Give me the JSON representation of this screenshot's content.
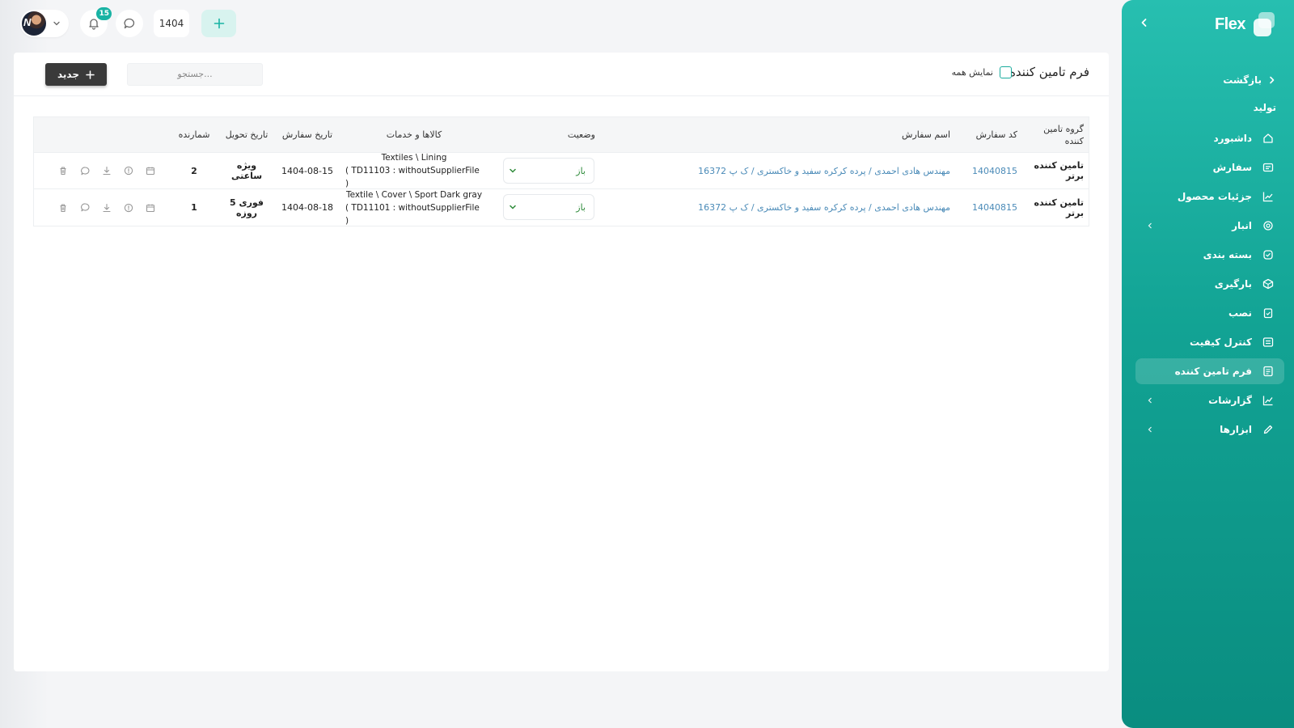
{
  "colors": {
    "accent": "#19b3a4",
    "link": "#4b8bb8",
    "status_open": "#2e8b3a",
    "dark_button": "#3a3a3a"
  },
  "topbar": {
    "avatar_initial": "N",
    "notifications_count": "15",
    "year": "1404"
  },
  "sidebar": {
    "logo": "Flex",
    "back_label": "بازگشت",
    "section_label": "تولید",
    "items": [
      {
        "label": "داشبورد",
        "icon": "home-icon"
      },
      {
        "label": "سفارش",
        "icon": "order-icon"
      },
      {
        "label": "جزئیات محصول",
        "icon": "chart-line-icon"
      },
      {
        "label": "انبار",
        "icon": "warehouse-icon",
        "has_children": true
      },
      {
        "label": "بسته بندی",
        "icon": "package-check-icon"
      },
      {
        "label": "بارگیری",
        "icon": "box-icon"
      },
      {
        "label": "نصب",
        "icon": "install-icon"
      },
      {
        "label": "کنترل کیفیت",
        "icon": "quality-icon"
      },
      {
        "label": "فرم تامین کننده",
        "icon": "form-icon",
        "active": true
      },
      {
        "label": "گزارشات",
        "icon": "report-icon",
        "has_children": true
      },
      {
        "label": "ابزارها",
        "icon": "pencil-icon",
        "has_children": true
      }
    ]
  },
  "page": {
    "title": "فرم تامین کننده",
    "show_all_label": "نمایش همه",
    "search_placeholder": "جستجو...",
    "new_button_label": "جدید"
  },
  "table": {
    "columns": {
      "group": "گروه تامین کننده",
      "code": "کد سفارش",
      "order_name": "اسم سفارش",
      "status": "وضعیت",
      "goods": "کالاها و خدمات",
      "order_date": "تاریخ سفارش",
      "delivery_date": "تاریخ تحویل",
      "counter": "شمارنده"
    },
    "rows": [
      {
        "group": "تامین کننده برتر",
        "code": "14040815",
        "order_name": "مهندس هادی احمدی / پرده کرکره سفید و خاکستری / ک پ 16372",
        "status": "باز",
        "goods_line1": "Textiles \\ Lining",
        "goods_line2": "( TD11103 : withoutSupplierFile )",
        "order_date": "1404-08-15",
        "delivery_date": "ویژه ساعتی",
        "counter": "2"
      },
      {
        "group": "تامین کننده برتر",
        "code": "14040815",
        "order_name": "مهندس هادی احمدی / پرده کرکره سفید و خاکستری / ک پ 16372",
        "status": "باز",
        "goods_line1": "Textile \\ Cover \\ Sport Dark gray",
        "goods_line2": "( TD11101 : withoutSupplierFile )",
        "order_date": "1404-08-18",
        "delivery_date": "فوری 5 روزه",
        "counter": "1"
      }
    ]
  }
}
